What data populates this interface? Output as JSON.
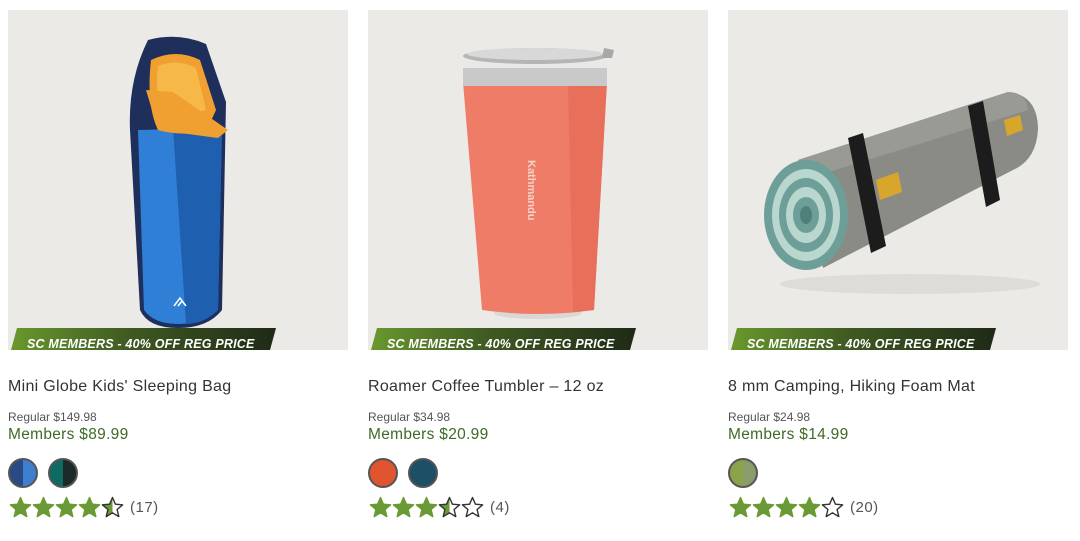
{
  "products": [
    {
      "name": "Mini Globe Kids' Sleeping Bag",
      "badge": "SC MEMBERS - 40% OFF REG PRICE",
      "regular_price": "Regular  $149.98",
      "members_price": "Members $89.99",
      "swatches": [
        {
          "colors": [
            "#2a4a86",
            "#3f7fcf"
          ]
        },
        {
          "colors": [
            "#0f6b62",
            "#1d2a2a"
          ]
        }
      ],
      "rating": 4.5,
      "review_count": "(17)"
    },
    {
      "name": "Roamer Coffee Tumbler – 12 oz",
      "badge": "SC MEMBERS - 40% OFF REG PRICE",
      "regular_price": "Regular  $34.98",
      "members_price": "Members $20.99",
      "swatches": [
        {
          "colors": [
            "#e0552f",
            "#e0552f"
          ]
        },
        {
          "colors": [
            "#1d4f66",
            "#1d4f66"
          ]
        }
      ],
      "rating": 3.5,
      "review_count": "(4)"
    },
    {
      "name": "8 mm Camping, Hiking Foam Mat",
      "badge": "SC MEMBERS - 40% OFF REG PRICE",
      "regular_price": "Regular  $24.98",
      "members_price": "Members $14.99",
      "swatches": [
        {
          "colors": [
            "#8aa24a",
            "#8a9c6a"
          ]
        }
      ],
      "rating": 4,
      "review_count": "(20)"
    }
  ],
  "colors": {
    "star_fill": "#6a9a35",
    "star_outline": "#333333",
    "members_price": "#3e6b25"
  }
}
